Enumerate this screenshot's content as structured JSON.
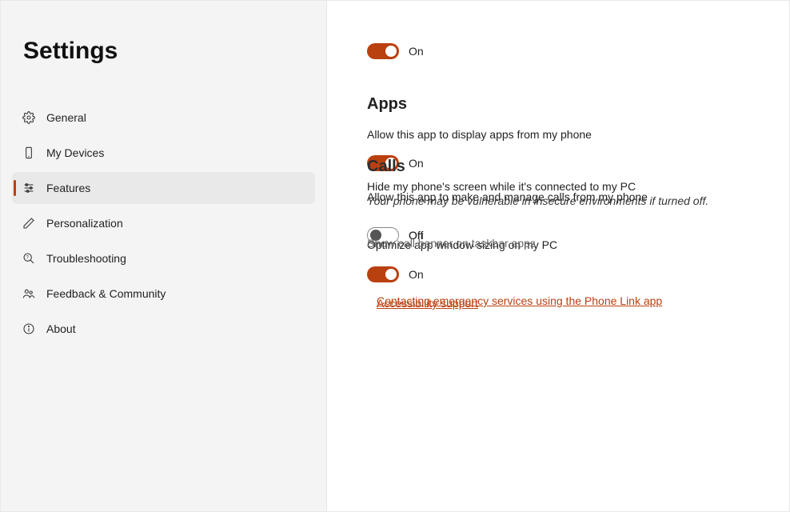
{
  "sidebar": {
    "title": "Settings",
    "items": [
      {
        "label": "General"
      },
      {
        "label": "My Devices"
      },
      {
        "label": "Features"
      },
      {
        "label": "Personalization"
      },
      {
        "label": "Troubleshooting"
      },
      {
        "label": "Feedback & Community"
      },
      {
        "label": "About"
      }
    ]
  },
  "top_toggle": {
    "state": "On"
  },
  "apps": {
    "heading": "Apps",
    "allow_display_label": "Allow this app to display apps from my phone",
    "allow_display_toggle": "On",
    "hide_screen_label": "Hide my phone's screen while it's connected to my PC",
    "hide_screen_sub": "Your phone may be vulnerable in insecure environments if turned off.",
    "hide_screen_toggle": "Off",
    "optimize_label": "Optimize app window sizing on my PC",
    "optimize_toggle": "On"
  },
  "calls": {
    "heading": "Calls",
    "allow_calls_label": "Allow this app to make and manage calls from my phone",
    "allow_calls_toggle": "On",
    "show_badge_label": "Show call banner on taskbar apps",
    "emergency_link": "Contacting emergency services using the Phone Link app"
  },
  "footer_link": "Accessibility support"
}
